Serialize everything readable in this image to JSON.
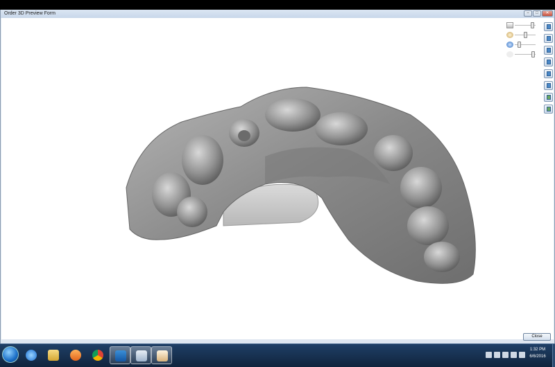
{
  "window": {
    "title": "Order 3D Preview Form",
    "controls": [
      "–",
      "□",
      "✕"
    ],
    "close_button_label": "Close"
  },
  "viewer": {
    "model": "dental-arch-3d-scan",
    "sliders": [
      {
        "name": "brightness",
        "value": 0.9
      },
      {
        "name": "tooth-opacity",
        "value": 0.5
      },
      {
        "name": "gum-opacity",
        "value": 0.2
      },
      {
        "name": "lighting",
        "value": 0.95
      }
    ],
    "view_buttons": [
      "view-front-icon",
      "view-back-icon",
      "view-left-icon",
      "view-right-icon",
      "view-top-icon",
      "view-bottom-icon",
      "scan-a-icon",
      "scan-b-icon"
    ]
  },
  "taskbar": {
    "icons": [
      "ie-icon",
      "folder-icon",
      "media-player-icon",
      "chrome-icon",
      "outlook-icon",
      "app-window-icon",
      "app-window-icon-2"
    ],
    "time": "1:32 PM",
    "date": "6/6/2016"
  },
  "colors": {
    "model": "#8c8c8c",
    "window_frame": "#dfe7f1",
    "taskbar": "#1a3557"
  }
}
